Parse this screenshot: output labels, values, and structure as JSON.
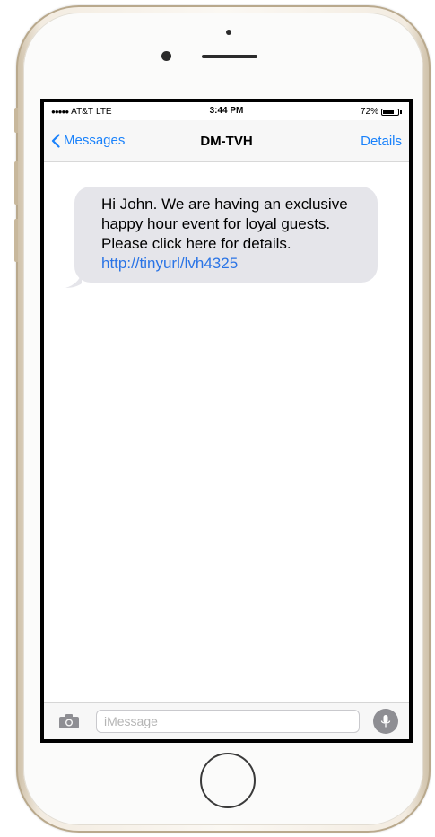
{
  "status_bar": {
    "signal": "●●●●●",
    "carrier": "AT&T",
    "network": "LTE",
    "time": "3:44 PM",
    "battery_text": "72%",
    "battery_level": 0.72
  },
  "nav": {
    "back_label": "Messages",
    "title": "DM-TVH",
    "details_label": "Details"
  },
  "message": {
    "text": "Hi John.  We are having an exclusive happy hour event for loyal guests. Please click here for details.  ",
    "link": "http://tinyurl/lvh4325"
  },
  "composer": {
    "placeholder": "iMessage",
    "value": ""
  },
  "icons": {
    "back": "chevron-left-icon",
    "camera": "camera-icon",
    "mic": "microphone-icon"
  },
  "colors": {
    "accent": "#1a82fb",
    "bubble": "#e5e5ea",
    "link": "#2a74e6"
  }
}
